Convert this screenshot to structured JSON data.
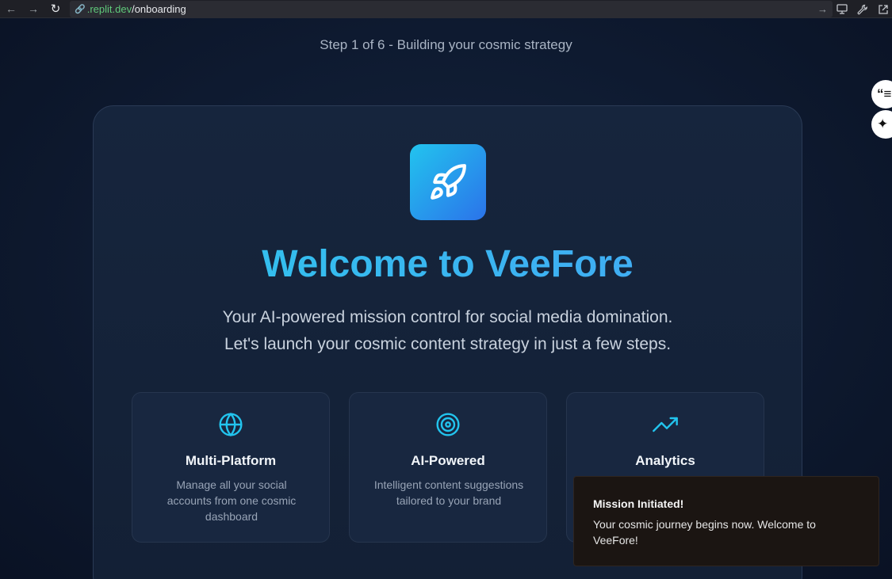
{
  "browser": {
    "url_domain": ".replit.dev",
    "url_path": "/onboarding"
  },
  "onboarding": {
    "step_label": "Step 1 of 6 - Building your cosmic strategy",
    "title": "Welcome to VeeFore",
    "subtitle_line1": "Your AI-powered mission control for social media domination.",
    "subtitle_line2": "Let's launch your cosmic content strategy in just a few steps.",
    "features": [
      {
        "title": "Multi-Platform",
        "description": "Manage all your social accounts from one cosmic dashboard",
        "icon": "globe-icon"
      },
      {
        "title": "AI-Powered",
        "description": "Intelligent content suggestions tailored to your brand",
        "icon": "target-icon"
      },
      {
        "title": "Analytics",
        "description": "",
        "icon": "trending-up-icon"
      }
    ]
  },
  "toast": {
    "title": "Mission Initiated!",
    "message": "Your cosmic journey begins now. Welcome to VeeFore!"
  },
  "colors": {
    "accent_cyan": "#22c4ee",
    "accent_blue": "#2b73ea",
    "background": "#0c1528"
  }
}
